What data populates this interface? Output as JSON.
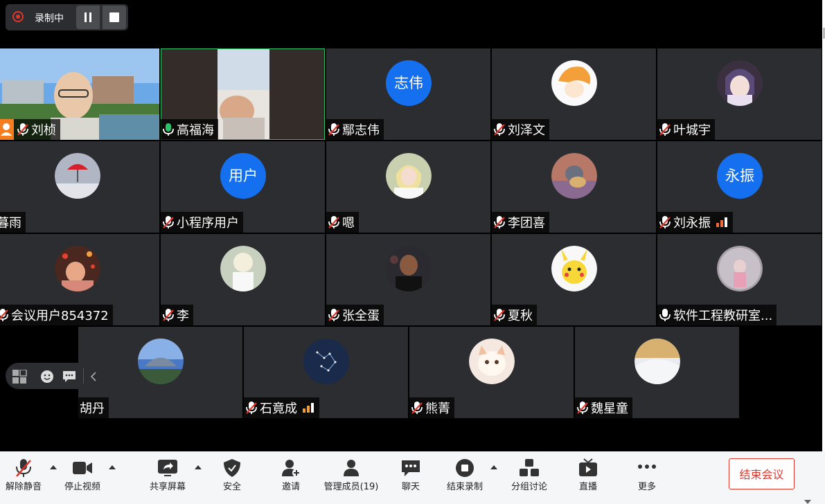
{
  "recording": {
    "label": "录制中"
  },
  "participants": [
    {
      "name": "刘桢",
      "type": "video",
      "muted": true,
      "host": true
    },
    {
      "name": "高福海",
      "type": "video",
      "muted": false,
      "active": true
    },
    {
      "name": "鄢志伟",
      "type": "text-avatar",
      "avatar_text": "志伟",
      "muted": true
    },
    {
      "name": "刘泽文",
      "type": "image-avatar",
      "avatar": "orange-hair-cartoon",
      "muted": true
    },
    {
      "name": "叶城宇",
      "type": "image-avatar",
      "avatar": "anime-girl",
      "muted": true
    },
    {
      "name": "暮雨",
      "type": "image-avatar",
      "avatar": "red-umbrella",
      "muted": true
    },
    {
      "name": "小程序用户",
      "type": "text-avatar",
      "avatar_text": "用户",
      "muted": true
    },
    {
      "name": "嗯",
      "type": "image-avatar",
      "avatar": "blonde-person",
      "muted": true
    },
    {
      "name": "李团喜",
      "type": "image-avatar",
      "avatar": "cartoon-cat",
      "muted": true
    },
    {
      "name": "刘永振",
      "type": "text-avatar",
      "avatar_text": "永振",
      "muted": true,
      "signal": true
    },
    {
      "name": "会议用户854372",
      "type": "image-avatar",
      "avatar": "person-red-lights",
      "muted": true
    },
    {
      "name": "李",
      "type": "image-avatar",
      "avatar": "flowers-face",
      "muted": true
    },
    {
      "name": "张全蛋",
      "type": "image-avatar",
      "avatar": "basketball-player",
      "muted": true
    },
    {
      "name": "夏秋",
      "type": "image-avatar",
      "avatar": "pikachu",
      "muted": true
    },
    {
      "name": "软件工程教研室...",
      "type": "image-avatar",
      "avatar": "pink-figure",
      "muted": false
    },
    {
      "name": "胡丹",
      "type": "image-avatar",
      "avatar": "landscape-sky",
      "muted": true
    },
    {
      "name": "石竟成",
      "type": "image-avatar",
      "avatar": "constellation",
      "muted": true,
      "signal": true
    },
    {
      "name": "熊菁",
      "type": "image-avatar",
      "avatar": "cute-cat",
      "muted": true
    },
    {
      "name": "魏星童",
      "type": "image-avatar",
      "avatar": "snow-scene",
      "muted": true
    }
  ],
  "toolbar": {
    "unmute": "解除静音",
    "stop_video": "停止视频",
    "share_screen": "共享屏幕",
    "security": "安全",
    "invite": "邀请",
    "manage_members": "管理成员(19)",
    "chat": "聊天",
    "end_recording": "结束录制",
    "breakout": "分组讨论",
    "live": "直播",
    "more": "更多",
    "end_meeting": "结束会议"
  },
  "colors": {
    "avatar_blue": "#1570ef",
    "end_red": "#e0352b",
    "active_green": "#2bc46a",
    "tile_bg": "#2b2d31"
  }
}
